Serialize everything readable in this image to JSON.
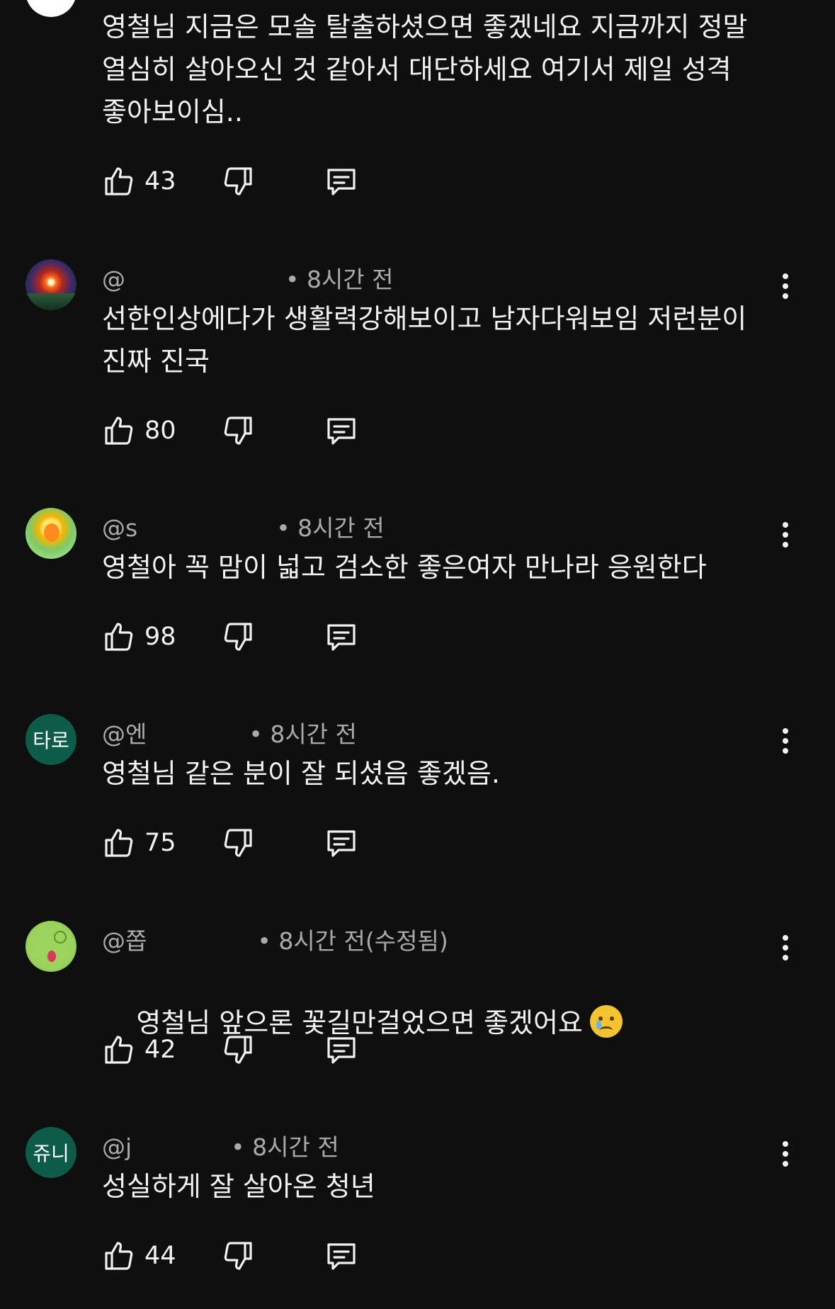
{
  "comments": [
    {
      "handle": "",
      "time": "",
      "body": "영철님 지금은 모솔 탈출하셨으면 좋겠네요 지금까지 정말\n열심히 살아오신 것 같아서 대단하세요 여기서 제일 성격\n좋아보이심..",
      "likes": "43",
      "avatar": "partial-avatar"
    },
    {
      "handle": "@",
      "time": "• 8시간 전",
      "body": "선한인상에다가 생활력강해보이고 남자다워보임 저런분이\n진짜 진국",
      "likes": "80",
      "avatar": "sunset-avatar"
    },
    {
      "handle": "@s",
      "time": "• 8시간 전",
      "body": "영철아 꼭 맘이 넓고 검소한 좋은여자 만나라 응원한다",
      "likes": "98",
      "avatar": "cartoon-avatar"
    },
    {
      "handle": "@엔",
      "time": "• 8시간 전",
      "body": "영철님 같은 분이 잘 되셨음 좋겠음.",
      "likes": "75",
      "avatar_text": "타로"
    },
    {
      "handle": "@쫍",
      "time": "• 8시간 전(수정됨)",
      "body": "영철님 앞으론 꽃길만걸었으면 좋겠어요",
      "emoji": "crying-face-emoji",
      "likes": "42",
      "avatar": "green-character-avatar"
    },
    {
      "handle": "@j",
      "time": "• 8시간 전",
      "body": "성실하게 잘 살아온 청년",
      "likes": "44",
      "avatar_text": "쥬니"
    }
  ],
  "icons": {
    "like": "thumbs-up-icon",
    "dislike": "thumbs-down-icon",
    "reply": "reply-icon",
    "more": "more-vert-icon"
  },
  "colors": {
    "background": "#0f0f0f",
    "text": "#f1f1f1",
    "meta": "#aaaaaa",
    "avatar_text_bg": "#0d5c4a"
  }
}
